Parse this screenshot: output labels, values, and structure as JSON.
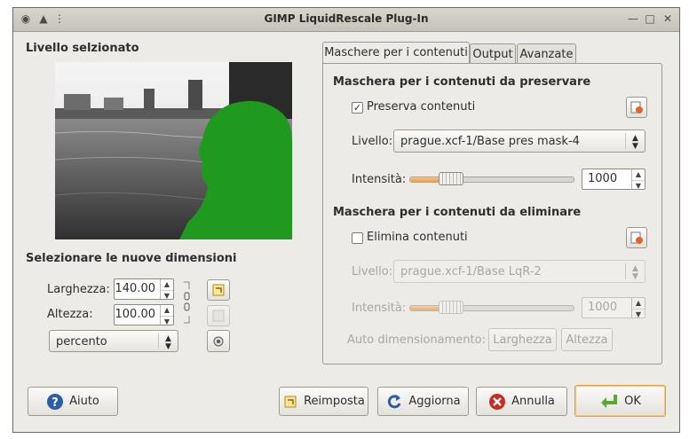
{
  "window": {
    "title": "GIMP LiquidRescale Plug-In"
  },
  "left": {
    "layer_heading": "Livello selzionato",
    "dims_heading": "Selezionare le nuove dimensioni",
    "width_label": "Larghezza:",
    "width_value": "140.00",
    "height_label": "Altezza:",
    "height_value": "100.00",
    "unit_value": "percento"
  },
  "tabs": [
    {
      "label": "Maschere per i contenuti",
      "active": true
    },
    {
      "label": "Output",
      "active": false
    },
    {
      "label": "Avanzate",
      "active": false
    }
  ],
  "preserve": {
    "heading": "Maschera per i contenuti da preservare",
    "checkbox_label": "Preserva contenuti",
    "checked": true,
    "layer_label": "Livello:",
    "layer_value": "prague.xcf-1/Base pres mask-4",
    "strength_label": "Intensità:",
    "strength_value": "1000",
    "slider_fraction": 0.25
  },
  "discard": {
    "heading": "Maschera per i contenuti da eliminare",
    "checkbox_label": "Elimina contenuti",
    "checked": false,
    "layer_label": "Livello:",
    "layer_value": "prague.xcf-1/Base LqR-2",
    "strength_label": "Intensità:",
    "strength_value": "1000",
    "slider_fraction": 0.25,
    "autosize_label": "Auto dimensionamento:",
    "autosize_width": "Larghezza",
    "autosize_height": "Altezza"
  },
  "buttons": {
    "help": "Aiuto",
    "reset": "Reimposta",
    "refresh": "Aggiorna",
    "cancel": "Annulla",
    "ok": "OK"
  },
  "colors": {
    "mask_green": "#1f9a1f",
    "accent_orange": "#eb9b4a",
    "help_blue": "#2c5da8",
    "cancel_red": "#cc2a1f",
    "ok_green": "#5aa832"
  }
}
